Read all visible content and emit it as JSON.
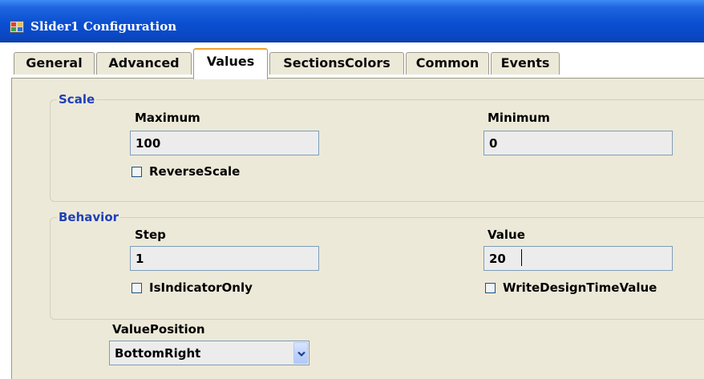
{
  "window": {
    "title": "Slider1 Configuration"
  },
  "tabs": [
    {
      "label": "General",
      "active": false
    },
    {
      "label": "Advanced",
      "active": false
    },
    {
      "label": "Values",
      "active": true
    },
    {
      "label": "SectionsColors",
      "active": false
    },
    {
      "label": "Common",
      "active": false
    },
    {
      "label": "Events",
      "active": false
    }
  ],
  "scale": {
    "legend": "Scale",
    "maximum_label": "Maximum",
    "maximum_value": "100",
    "minimum_label": "Minimum",
    "minimum_value": "0",
    "reverse_scale_label": "ReverseScale",
    "reverse_scale_checked": false
  },
  "behavior": {
    "legend": "Behavior",
    "step_label": "Step",
    "step_value": "1",
    "value_label": "Value",
    "value_value": "20",
    "is_indicator_only_label": "IsIndicatorOnly",
    "is_indicator_only_checked": false,
    "write_design_time_value_label": "WriteDesignTimeValue",
    "write_design_time_value_checked": false
  },
  "value_position": {
    "label": "ValuePosition",
    "selected": "BottomRight"
  },
  "icons": {
    "app": "window-app-icon",
    "dropdown": "chevron-down-icon"
  },
  "colors": {
    "titlebar": "#0a4fd0",
    "panel": "#ece9d8",
    "legend_text": "#1f3fb8",
    "active_tab_accent": "#f0a030"
  }
}
